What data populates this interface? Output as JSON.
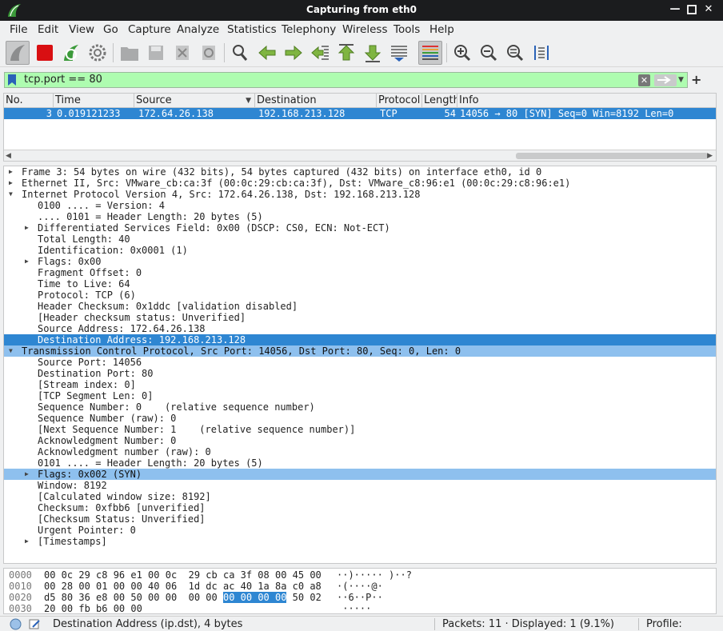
{
  "window": {
    "title": "Capturing from eth0",
    "accent": "#2e86d2"
  },
  "menu": [
    "File",
    "Edit",
    "View",
    "Go",
    "Capture",
    "Analyze",
    "Statistics",
    "Telephony",
    "Wireless",
    "Tools",
    "Help"
  ],
  "toolbar": [
    "shark-fin-start-icon",
    "stop-capture-icon",
    "restart-capture-icon",
    "capture-options-icon",
    "open-file-icon",
    "save-file-icon",
    "close-file-icon",
    "reload-file-icon",
    "find-packet-icon",
    "go-back-icon",
    "go-forward-icon",
    "go-to-packet-icon",
    "first-packet-icon",
    "last-packet-icon",
    "autoscroll-icon",
    "colorize-icon",
    "zoom-in-icon",
    "zoom-out-icon",
    "zoom-normal-icon",
    "resize-columns-icon"
  ],
  "filter": {
    "value": "tcp.port == 80",
    "bg": "#aefcb0"
  },
  "packet_list": {
    "columns": [
      "No.",
      "Time",
      "Source",
      "Destination",
      "Protocol",
      "Length",
      "Info"
    ],
    "rows": [
      {
        "no": "3",
        "time": "0.019121233",
        "source": "172.64.26.138",
        "destination": "192.168.213.128",
        "protocol": "TCP",
        "length": "54",
        "info": "14056 → 80 [SYN] Seq=0 Win=8192 Len=0"
      }
    ]
  },
  "details": [
    {
      "text": "Frame 3: 54 bytes on wire (432 bits), 54 bytes captured (432 bits) on interface eth0, id 0",
      "indent": 0,
      "arrow": "right"
    },
    {
      "text": "Ethernet II, Src: VMware_cb:ca:3f (00:0c:29:cb:ca:3f), Dst: VMware_c8:96:e1 (00:0c:29:c8:96:e1)",
      "indent": 0,
      "arrow": "right"
    },
    {
      "text": "Internet Protocol Version 4, Src: 172.64.26.138, Dst: 192.168.213.128",
      "indent": 0,
      "arrow": "down"
    },
    {
      "text": "0100 .... = Version: 4",
      "indent": 1,
      "arrow": ""
    },
    {
      "text": ".... 0101 = Header Length: 20 bytes (5)",
      "indent": 1,
      "arrow": ""
    },
    {
      "text": "Differentiated Services Field: 0x00 (DSCP: CS0, ECN: Not-ECT)",
      "indent": 1,
      "arrow": "right"
    },
    {
      "text": "Total Length: 40",
      "indent": 1,
      "arrow": ""
    },
    {
      "text": "Identification: 0x0001 (1)",
      "indent": 1,
      "arrow": ""
    },
    {
      "text": "Flags: 0x00",
      "indent": 1,
      "arrow": "right"
    },
    {
      "text": "Fragment Offset: 0",
      "indent": 1,
      "arrow": ""
    },
    {
      "text": "Time to Live: 64",
      "indent": 1,
      "arrow": ""
    },
    {
      "text": "Protocol: TCP (6)",
      "indent": 1,
      "arrow": ""
    },
    {
      "text": "Header Checksum: 0x1ddc [validation disabled]",
      "indent": 1,
      "arrow": ""
    },
    {
      "text": "[Header checksum status: Unverified]",
      "indent": 1,
      "arrow": ""
    },
    {
      "text": "Source Address: 172.64.26.138",
      "indent": 1,
      "arrow": ""
    },
    {
      "text": "Destination Address: 192.168.213.128",
      "indent": 1,
      "arrow": "",
      "state": "selected"
    },
    {
      "text": "Transmission Control Protocol, Src Port: 14056, Dst Port: 80, Seq: 0, Len: 0",
      "indent": 0,
      "arrow": "down",
      "state": "related"
    },
    {
      "text": "Source Port: 14056",
      "indent": 1,
      "arrow": ""
    },
    {
      "text": "Destination Port: 80",
      "indent": 1,
      "arrow": ""
    },
    {
      "text": "[Stream index: 0]",
      "indent": 1,
      "arrow": ""
    },
    {
      "text": "[TCP Segment Len: 0]",
      "indent": 1,
      "arrow": ""
    },
    {
      "text": "Sequence Number: 0    (relative sequence number)",
      "indent": 1,
      "arrow": ""
    },
    {
      "text": "Sequence Number (raw): 0",
      "indent": 1,
      "arrow": ""
    },
    {
      "text": "[Next Sequence Number: 1    (relative sequence number)]",
      "indent": 1,
      "arrow": ""
    },
    {
      "text": "Acknowledgment Number: 0",
      "indent": 1,
      "arrow": ""
    },
    {
      "text": "Acknowledgment number (raw): 0",
      "indent": 1,
      "arrow": ""
    },
    {
      "text": "0101 .... = Header Length: 20 bytes (5)",
      "indent": 1,
      "arrow": ""
    },
    {
      "text": "Flags: 0x002 (SYN)",
      "indent": 1,
      "arrow": "right",
      "state": "related"
    },
    {
      "text": "Window: 8192",
      "indent": 1,
      "arrow": ""
    },
    {
      "text": "[Calculated window size: 8192]",
      "indent": 1,
      "arrow": ""
    },
    {
      "text": "Checksum: 0xfbb6 [unverified]",
      "indent": 1,
      "arrow": ""
    },
    {
      "text": "[Checksum Status: Unverified]",
      "indent": 1,
      "arrow": ""
    },
    {
      "text": "Urgent Pointer: 0",
      "indent": 1,
      "arrow": ""
    },
    {
      "text": "[Timestamps]",
      "indent": 1,
      "arrow": "right"
    }
  ],
  "hex": [
    {
      "offset": "0000",
      "pre": "00 0c 29 c8 96 e1 00 0c  29 cb ca 3f 08 00 45 00",
      "sel": "",
      "post": "",
      "ascii": "··)····· )··?"
    },
    {
      "offset": "0010",
      "pre": "00 28 00 01 00 00 40 06  1d dc ac 40 1a 8a c0 a8",
      "sel": "",
      "post": "",
      "ascii": "·(····@·"
    },
    {
      "offset": "0020",
      "pre": "d5 80 36 e8 00 50 00 00  00 00 ",
      "sel": "00 00 00 00",
      "post": " 50 02",
      "ascii": "··6··P··"
    },
    {
      "offset": "0030",
      "pre": "20 00 fb b6 00 00",
      "sel": "",
      "post": "",
      "ascii": " ·····"
    }
  ],
  "status": {
    "field": "Destination Address (ip.dst), 4 bytes",
    "packets": "Packets: 11 · Displayed: 1 (9.1%)",
    "profile": "Profile: Default"
  }
}
